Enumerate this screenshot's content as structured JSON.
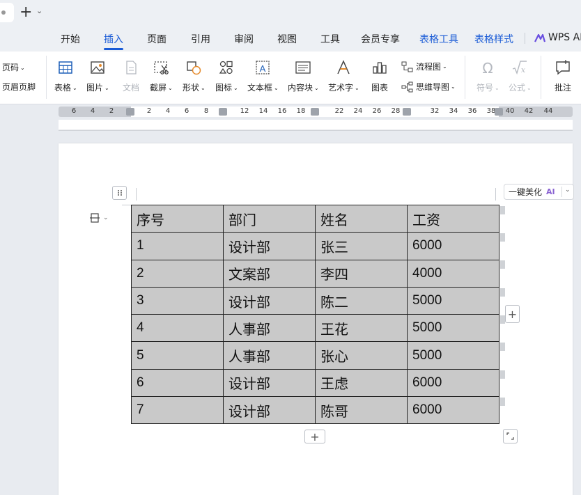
{
  "menu": {
    "items": [
      "开始",
      "插入",
      "页面",
      "引用",
      "审阅",
      "视图",
      "工具",
      "会员专享",
      "表格工具",
      "表格样式",
      "WPS AI"
    ],
    "active": "插入"
  },
  "ribbon": {
    "left": {
      "page_number": "页码",
      "header_footer": "页眉页脚"
    },
    "tools": {
      "table": "表格",
      "picture": "图片",
      "document": "文档",
      "screenshot": "截屏",
      "shape": "形状",
      "icon": "图标",
      "textbox": "文本框",
      "content_block": "内容块",
      "wordart": "艺术字",
      "chart": "图表",
      "symbol": "符号",
      "formula": "公式",
      "comment": "批注"
    },
    "flowchart": "流程图",
    "mindmap": "思维导图"
  },
  "ruler": {
    "labels": [
      "6",
      "4",
      "2",
      "2",
      "4",
      "6",
      "8",
      "12",
      "14",
      "16",
      "18",
      "22",
      "24",
      "26",
      "28",
      "32",
      "34",
      "36",
      "38",
      "40",
      "42",
      "44"
    ]
  },
  "table_tools": {
    "beautify_label": "一键美化",
    "ai_badge": "AI",
    "add_symbol": "+"
  },
  "table": {
    "headers": [
      "序号",
      "部门",
      "姓名",
      "工资"
    ],
    "rows": [
      [
        "1",
        "设计部",
        "张三",
        "6000"
      ],
      [
        "2",
        "文案部",
        "李四",
        "4000"
      ],
      [
        "3",
        "设计部",
        "陈二",
        "5000"
      ],
      [
        "4",
        "人事部",
        "王花",
        "5000"
      ],
      [
        "5",
        "人事部",
        "张心",
        "5000"
      ],
      [
        "6",
        "设计部",
        "王虑",
        "6000"
      ],
      [
        "7",
        "设计部",
        "陈哥",
        "6000"
      ]
    ]
  }
}
